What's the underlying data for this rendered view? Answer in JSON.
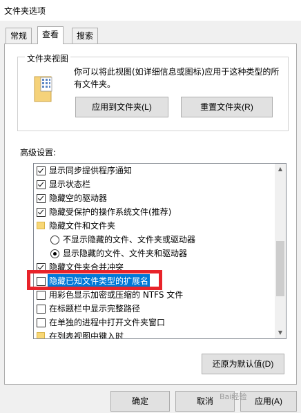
{
  "window": {
    "title": "文件夹选项"
  },
  "tabs": [
    {
      "label": "常规",
      "active": false
    },
    {
      "label": "查看",
      "active": true
    },
    {
      "label": "搜索",
      "active": false
    }
  ],
  "folder_view": {
    "label": "文件夹视图",
    "description": "你可以将此视图(如详细信息或图标)应用于这种类型的所有文件夹。",
    "apply_button": "应用到文件夹(L)",
    "reset_button": "重置文件夹(R)"
  },
  "advanced": {
    "label": "高级设置:",
    "items": [
      {
        "type": "checkbox",
        "checked": true,
        "label": "显示同步提供程序通知"
      },
      {
        "type": "checkbox",
        "checked": true,
        "label": "显示状态栏"
      },
      {
        "type": "checkbox",
        "checked": true,
        "label": "隐藏空的驱动器"
      },
      {
        "type": "checkbox",
        "checked": true,
        "label": "隐藏受保护的操作系统文件(推荐)"
      },
      {
        "type": "folder",
        "label": "隐藏文件和文件夹"
      },
      {
        "type": "radio",
        "checked": false,
        "label": "不显示隐藏的文件、文件夹或驱动器"
      },
      {
        "type": "radio",
        "checked": true,
        "label": "显示隐藏的文件、文件夹和驱动器"
      },
      {
        "type": "checkbox",
        "checked": true,
        "label": "隐藏文件夹合并冲突"
      },
      {
        "type": "checkbox",
        "checked": false,
        "label": "隐藏已知文件类型的扩展名",
        "selected": true
      },
      {
        "type": "checkbox",
        "checked": false,
        "label": "用彩色显示加密或压缩的 NTFS 文件"
      },
      {
        "type": "checkbox",
        "checked": false,
        "label": "在标题栏中显示完整路径"
      },
      {
        "type": "checkbox",
        "checked": false,
        "label": "在单独的进程中打开文件夹窗口"
      },
      {
        "type": "folder",
        "label": "在列表视图中键入时"
      }
    ],
    "restore_button": "还原为默认值(D)"
  },
  "footer": {
    "ok_button": "确定",
    "cancel_button": "取消",
    "apply_button": "应用(A)"
  },
  "colors": {
    "selection": "#0078d7",
    "highlight_box": "#e8232a"
  },
  "watermark": "Bai经验"
}
